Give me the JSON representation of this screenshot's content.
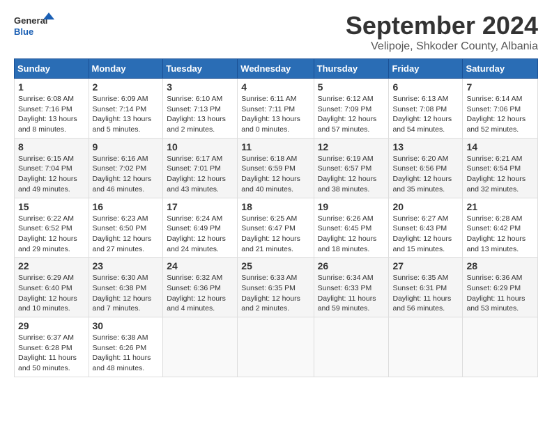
{
  "header": {
    "logo_general": "General",
    "logo_blue": "Blue",
    "title": "September 2024",
    "subtitle": "Velipoje, Shkoder County, Albania"
  },
  "columns": [
    "Sunday",
    "Monday",
    "Tuesday",
    "Wednesday",
    "Thursday",
    "Friday",
    "Saturday"
  ],
  "weeks": [
    [
      {
        "day": "1",
        "sunrise": "6:08 AM",
        "sunset": "7:16 PM",
        "daylight": "13 hours and 8 minutes."
      },
      {
        "day": "2",
        "sunrise": "6:09 AM",
        "sunset": "7:14 PM",
        "daylight": "13 hours and 5 minutes."
      },
      {
        "day": "3",
        "sunrise": "6:10 AM",
        "sunset": "7:13 PM",
        "daylight": "13 hours and 2 minutes."
      },
      {
        "day": "4",
        "sunrise": "6:11 AM",
        "sunset": "7:11 PM",
        "daylight": "13 hours and 0 minutes."
      },
      {
        "day": "5",
        "sunrise": "6:12 AM",
        "sunset": "7:09 PM",
        "daylight": "12 hours and 57 minutes."
      },
      {
        "day": "6",
        "sunrise": "6:13 AM",
        "sunset": "7:08 PM",
        "daylight": "12 hours and 54 minutes."
      },
      {
        "day": "7",
        "sunrise": "6:14 AM",
        "sunset": "7:06 PM",
        "daylight": "12 hours and 52 minutes."
      }
    ],
    [
      {
        "day": "8",
        "sunrise": "6:15 AM",
        "sunset": "7:04 PM",
        "daylight": "12 hours and 49 minutes."
      },
      {
        "day": "9",
        "sunrise": "6:16 AM",
        "sunset": "7:02 PM",
        "daylight": "12 hours and 46 minutes."
      },
      {
        "day": "10",
        "sunrise": "6:17 AM",
        "sunset": "7:01 PM",
        "daylight": "12 hours and 43 minutes."
      },
      {
        "day": "11",
        "sunrise": "6:18 AM",
        "sunset": "6:59 PM",
        "daylight": "12 hours and 40 minutes."
      },
      {
        "day": "12",
        "sunrise": "6:19 AM",
        "sunset": "6:57 PM",
        "daylight": "12 hours and 38 minutes."
      },
      {
        "day": "13",
        "sunrise": "6:20 AM",
        "sunset": "6:56 PM",
        "daylight": "12 hours and 35 minutes."
      },
      {
        "day": "14",
        "sunrise": "6:21 AM",
        "sunset": "6:54 PM",
        "daylight": "12 hours and 32 minutes."
      }
    ],
    [
      {
        "day": "15",
        "sunrise": "6:22 AM",
        "sunset": "6:52 PM",
        "daylight": "12 hours and 29 minutes."
      },
      {
        "day": "16",
        "sunrise": "6:23 AM",
        "sunset": "6:50 PM",
        "daylight": "12 hours and 27 minutes."
      },
      {
        "day": "17",
        "sunrise": "6:24 AM",
        "sunset": "6:49 PM",
        "daylight": "12 hours and 24 minutes."
      },
      {
        "day": "18",
        "sunrise": "6:25 AM",
        "sunset": "6:47 PM",
        "daylight": "12 hours and 21 minutes."
      },
      {
        "day": "19",
        "sunrise": "6:26 AM",
        "sunset": "6:45 PM",
        "daylight": "12 hours and 18 minutes."
      },
      {
        "day": "20",
        "sunrise": "6:27 AM",
        "sunset": "6:43 PM",
        "daylight": "12 hours and 15 minutes."
      },
      {
        "day": "21",
        "sunrise": "6:28 AM",
        "sunset": "6:42 PM",
        "daylight": "12 hours and 13 minutes."
      }
    ],
    [
      {
        "day": "22",
        "sunrise": "6:29 AM",
        "sunset": "6:40 PM",
        "daylight": "12 hours and 10 minutes."
      },
      {
        "day": "23",
        "sunrise": "6:30 AM",
        "sunset": "6:38 PM",
        "daylight": "12 hours and 7 minutes."
      },
      {
        "day": "24",
        "sunrise": "6:32 AM",
        "sunset": "6:36 PM",
        "daylight": "12 hours and 4 minutes."
      },
      {
        "day": "25",
        "sunrise": "6:33 AM",
        "sunset": "6:35 PM",
        "daylight": "12 hours and 2 minutes."
      },
      {
        "day": "26",
        "sunrise": "6:34 AM",
        "sunset": "6:33 PM",
        "daylight": "11 hours and 59 minutes."
      },
      {
        "day": "27",
        "sunrise": "6:35 AM",
        "sunset": "6:31 PM",
        "daylight": "11 hours and 56 minutes."
      },
      {
        "day": "28",
        "sunrise": "6:36 AM",
        "sunset": "6:29 PM",
        "daylight": "11 hours and 53 minutes."
      }
    ],
    [
      {
        "day": "29",
        "sunrise": "6:37 AM",
        "sunset": "6:28 PM",
        "daylight": "11 hours and 50 minutes."
      },
      {
        "day": "30",
        "sunrise": "6:38 AM",
        "sunset": "6:26 PM",
        "daylight": "11 hours and 48 minutes."
      },
      null,
      null,
      null,
      null,
      null
    ]
  ],
  "labels": {
    "sunrise": "Sunrise: ",
    "sunset": "Sunset: ",
    "daylight": "Daylight: "
  }
}
